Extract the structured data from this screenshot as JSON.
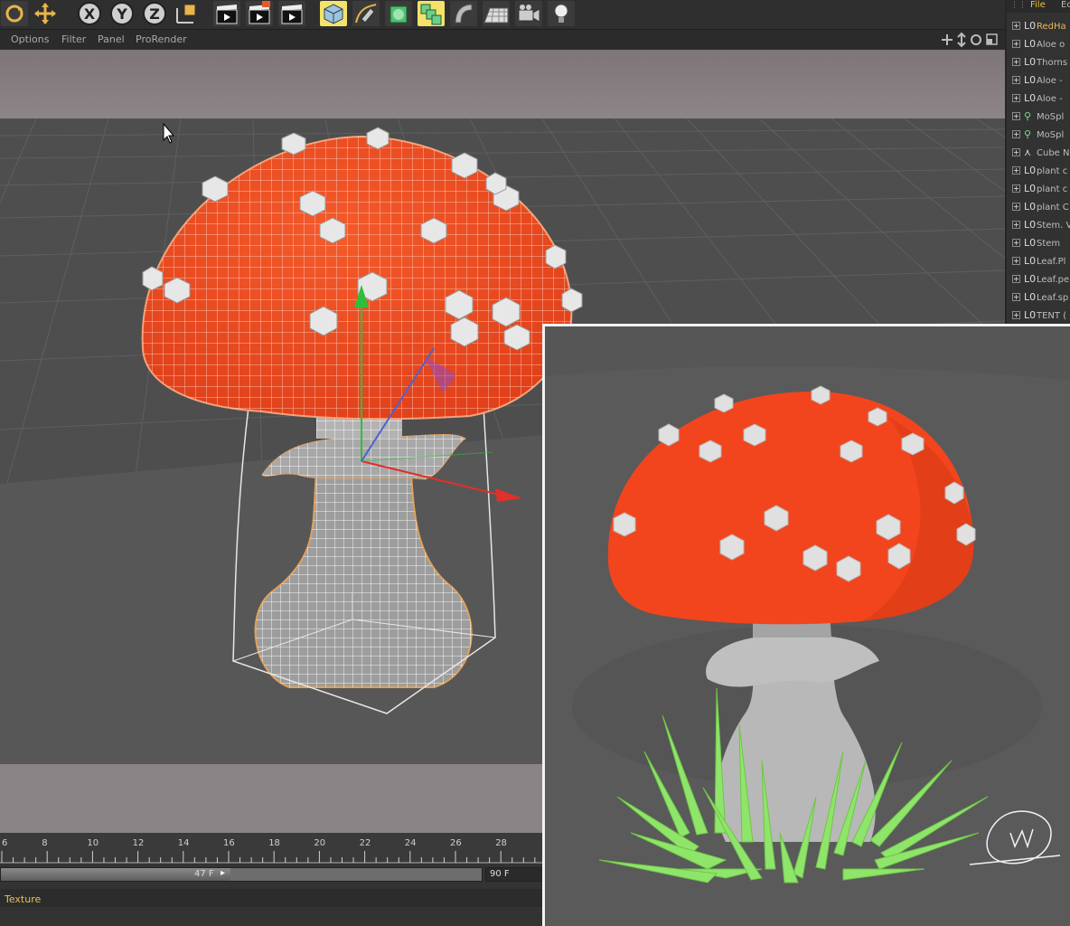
{
  "toolbar": {
    "axis_buttons": [
      "X",
      "Y",
      "Z"
    ]
  },
  "menubar": {
    "items": [
      "Options",
      "Filter",
      "Panel",
      "ProRender"
    ]
  },
  "timeline": {
    "ticks": [
      "6",
      "8",
      "10",
      "12",
      "14",
      "16",
      "18",
      "20",
      "22",
      "24",
      "26",
      "28"
    ],
    "current_frame": "47 F",
    "end_frame": "90 F",
    "attributes_tab": "Texture"
  },
  "object_manager": {
    "menu": [
      "File",
      "Ec"
    ],
    "objects": [
      "RedHa",
      "Aloe o",
      "Thorns",
      "Aloe -",
      "Aloe -",
      "MoSpl",
      "MoSpl",
      "Cube N",
      "plant c",
      "plant c",
      "plant C",
      "Stem. V",
      "Stem",
      "Leaf.Pl",
      "Leaf.pe",
      "Leaf.sp",
      "TENT ("
    ]
  },
  "colors": {
    "cap_red": "#f2451d",
    "grass_green": "#8fe56a",
    "highlight_yellow": "#f3e36a",
    "active_item": "#e9b95e"
  }
}
